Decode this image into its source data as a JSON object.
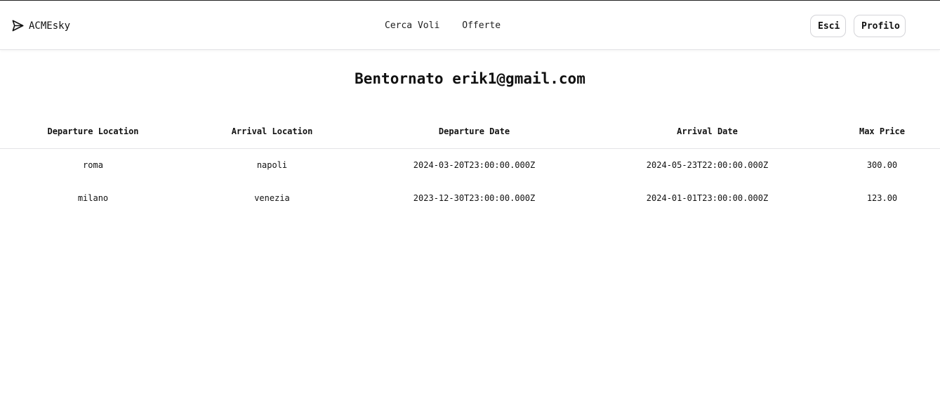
{
  "header": {
    "brand": "ACMEsky",
    "nav": [
      "Cerca Voli",
      "Offerte"
    ],
    "logout_label": "Esci",
    "profile_label": "Profilo"
  },
  "main": {
    "welcome": "Bentornato erik1@gmail.com",
    "table": {
      "columns": [
        "Departure Location",
        "Arrival Location",
        "Departure Date",
        "Arrival Date",
        "Max Price"
      ],
      "rows": [
        [
          "roma",
          "napoli",
          "2024-03-20T23:00:00.000Z",
          "2024-05-23T22:00:00.000Z",
          "300.00"
        ],
        [
          "milano",
          "venezia",
          "2023-12-30T23:00:00.000Z",
          "2024-01-01T23:00:00.000Z",
          "123.00"
        ]
      ]
    }
  },
  "icons": {
    "brand_icon": "paper-plane-icon"
  }
}
